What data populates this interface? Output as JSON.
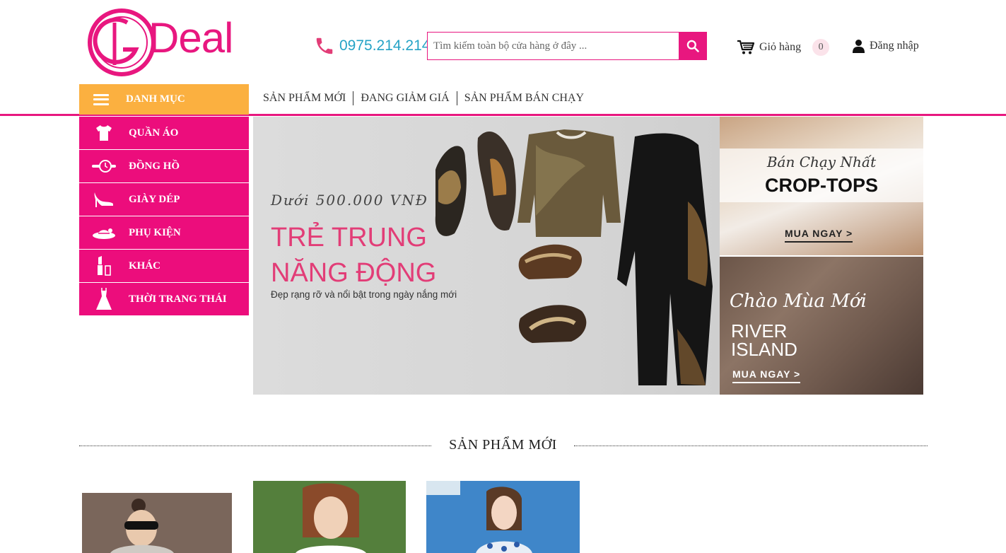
{
  "brand": {
    "name": "Deal",
    "accent": "#e8177f",
    "accent_secondary": "#fbb040"
  },
  "header": {
    "phone": "0975.214.214",
    "search": {
      "placeholder": "Tìm kiếm toàn bộ cửa hàng ở đây ..."
    },
    "cart_label": "Giỏ hàng",
    "cart_count": "0",
    "login_label": "Đăng nhập"
  },
  "nav": {
    "category_label": "DANH MỤC",
    "links": [
      "SẢN PHẨM MỚI",
      "ĐANG GIẢM GIÁ",
      "SẢN PHẨM BÁN CHẠY"
    ]
  },
  "sidebar": {
    "items": [
      {
        "label": "QUẦN ÁO",
        "icon": "shirt-icon"
      },
      {
        "label": "ĐỒNG HỒ",
        "icon": "watch-icon"
      },
      {
        "label": "GIÀY DÉP",
        "icon": "high-heel-icon"
      },
      {
        "label": "PHỤ KIỆN",
        "icon": "hat-icon"
      },
      {
        "label": "KHÁC",
        "icon": "lipstick-icon"
      },
      {
        "label": "THỜI TRANG THÁI",
        "icon": "dress-icon"
      }
    ]
  },
  "hero": {
    "script": "Dưới 500.000 VNĐ",
    "title_line1": "TRẺ TRUNG",
    "title_line2": "NĂNG ĐỘNG",
    "subtitle": "Đẹp rạng rỡ và nổi bật trong ngày nắng mới"
  },
  "promos": [
    {
      "script": "Bán Chạy Nhất",
      "title": "CROP-TOPS",
      "cta": "MUA NGAY  >"
    },
    {
      "script": "Chào Mùa Mới",
      "title_line1": "RIVER",
      "title_line2": "ISLAND",
      "cta": "MUA NGAY  >"
    }
  ],
  "section": {
    "title": "SẢN PHẨM MỚI"
  }
}
